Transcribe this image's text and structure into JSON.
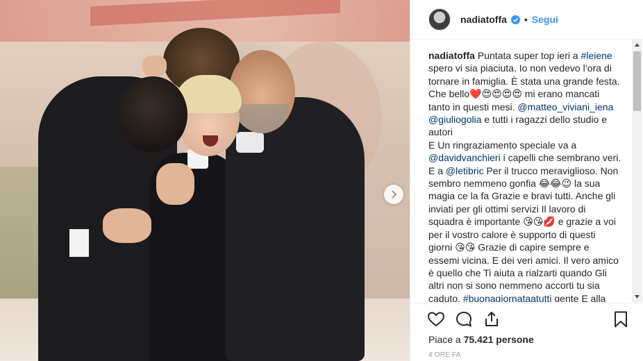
{
  "header": {
    "username": "nadiatoffa",
    "separator": "•",
    "follow_label": "Segui"
  },
  "caption": {
    "username": "nadiatoffa",
    "parts": [
      {
        "text": "Puntata super top ieri a ",
        "tag": false
      },
      {
        "text": "#leiene",
        "tag": true
      },
      {
        "text": " spero vi sia piaciuta. Io non vedevo l’ora di tornare in famiglia. È stata una grande festa. Che bello❤️😍😍😍😍 mi erano mancati tanto in questi mesi. ",
        "tag": false
      },
      {
        "text": "@matteo_viviani_iena",
        "tag": true
      },
      {
        "text": " ",
        "tag": false
      },
      {
        "text": "@giuliogolia",
        "tag": true
      },
      {
        "text": " e tutti i ragazzi dello studio e autori\nE Un ringraziamento speciale va a ",
        "tag": false
      },
      {
        "text": "@davidvanchieri",
        "tag": true
      },
      {
        "text": " i capelli che sembrano veri. E a ",
        "tag": false
      },
      {
        "text": "@letibric",
        "tag": true
      },
      {
        "text": " Per il trucco meraviglioso. Non sembro nemmeno gonfia 😂😂😉 la sua magia ce la fa Grazie e bravi tutti. Anche gli inviati per gli ottimi servizi Il lavoro di squadra è importante 😘😘💋 e grazie a voi per il vostro calore è supporto di questi giorni 😘😘 Grazie di capire sempre e essemi vicina. E dei veri amici. Il vero amico è quello che Ti aiuta a rialzarti quando Gli altri non si sono nemmeno accorti tu sia caduto. ",
        "tag": false
      },
      {
        "text": "#buonagiornataatutti",
        "tag": true
      },
      {
        "text": " gente E alla prossima diretta 😘😘💋",
        "tag": false
      }
    ]
  },
  "likes": {
    "prefix": "Piace a ",
    "count": "75.421",
    "suffix": " persone"
  },
  "timestamp": "4 ore fa",
  "icons": {
    "verified": "verified-badge-icon",
    "like": "heart-icon",
    "comment": "comment-bubble-icon",
    "share": "share-icon",
    "save": "bookmark-icon",
    "next": "chevron-right-icon"
  },
  "colors": {
    "link": "#3897f0",
    "tag": "#003569",
    "text": "#262626",
    "muted": "#999999",
    "border": "#efefef"
  }
}
